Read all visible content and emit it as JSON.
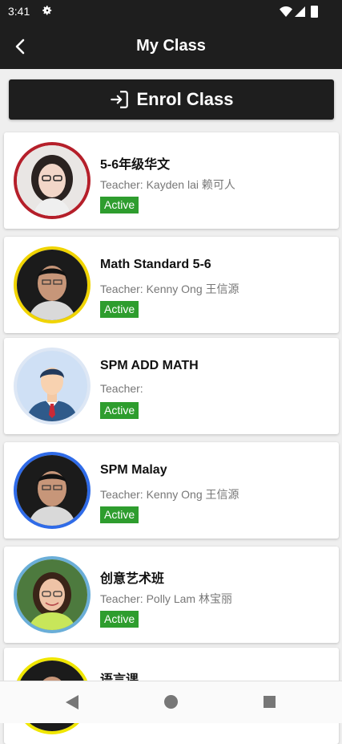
{
  "status": {
    "time": "3:41"
  },
  "header": {
    "title": "My Class"
  },
  "enrol": {
    "label": "Enrol Class"
  },
  "classes": [
    {
      "name": "5-6年级华文",
      "teacher": "Teacher: Kayden lai 赖可人",
      "status": "Active",
      "ring": "#b51f2a"
    },
    {
      "name": "Math Standard 5-6",
      "teacher": "Teacher: Kenny Ong 王信源",
      "status": "Active",
      "ring": "#f0d400"
    },
    {
      "name": "SPM ADD MATH",
      "teacher": "Teacher:",
      "status": "Active",
      "ring": "#dde7f5"
    },
    {
      "name": "SPM Malay",
      "teacher": "Teacher: Kenny Ong 王信源",
      "status": "Active",
      "ring": "#2f6be8"
    },
    {
      "name": "创意艺术班",
      "teacher": "Teacher: Polly Lam 林宝丽",
      "status": "Active",
      "ring": "#6aaed8"
    },
    {
      "name": "语言课",
      "teacher": "",
      "status": "",
      "ring": "#f0e600"
    }
  ],
  "colors": {
    "bar": "#1e1e1e",
    "active": "#2e9d2e",
    "background": "#efefef"
  }
}
